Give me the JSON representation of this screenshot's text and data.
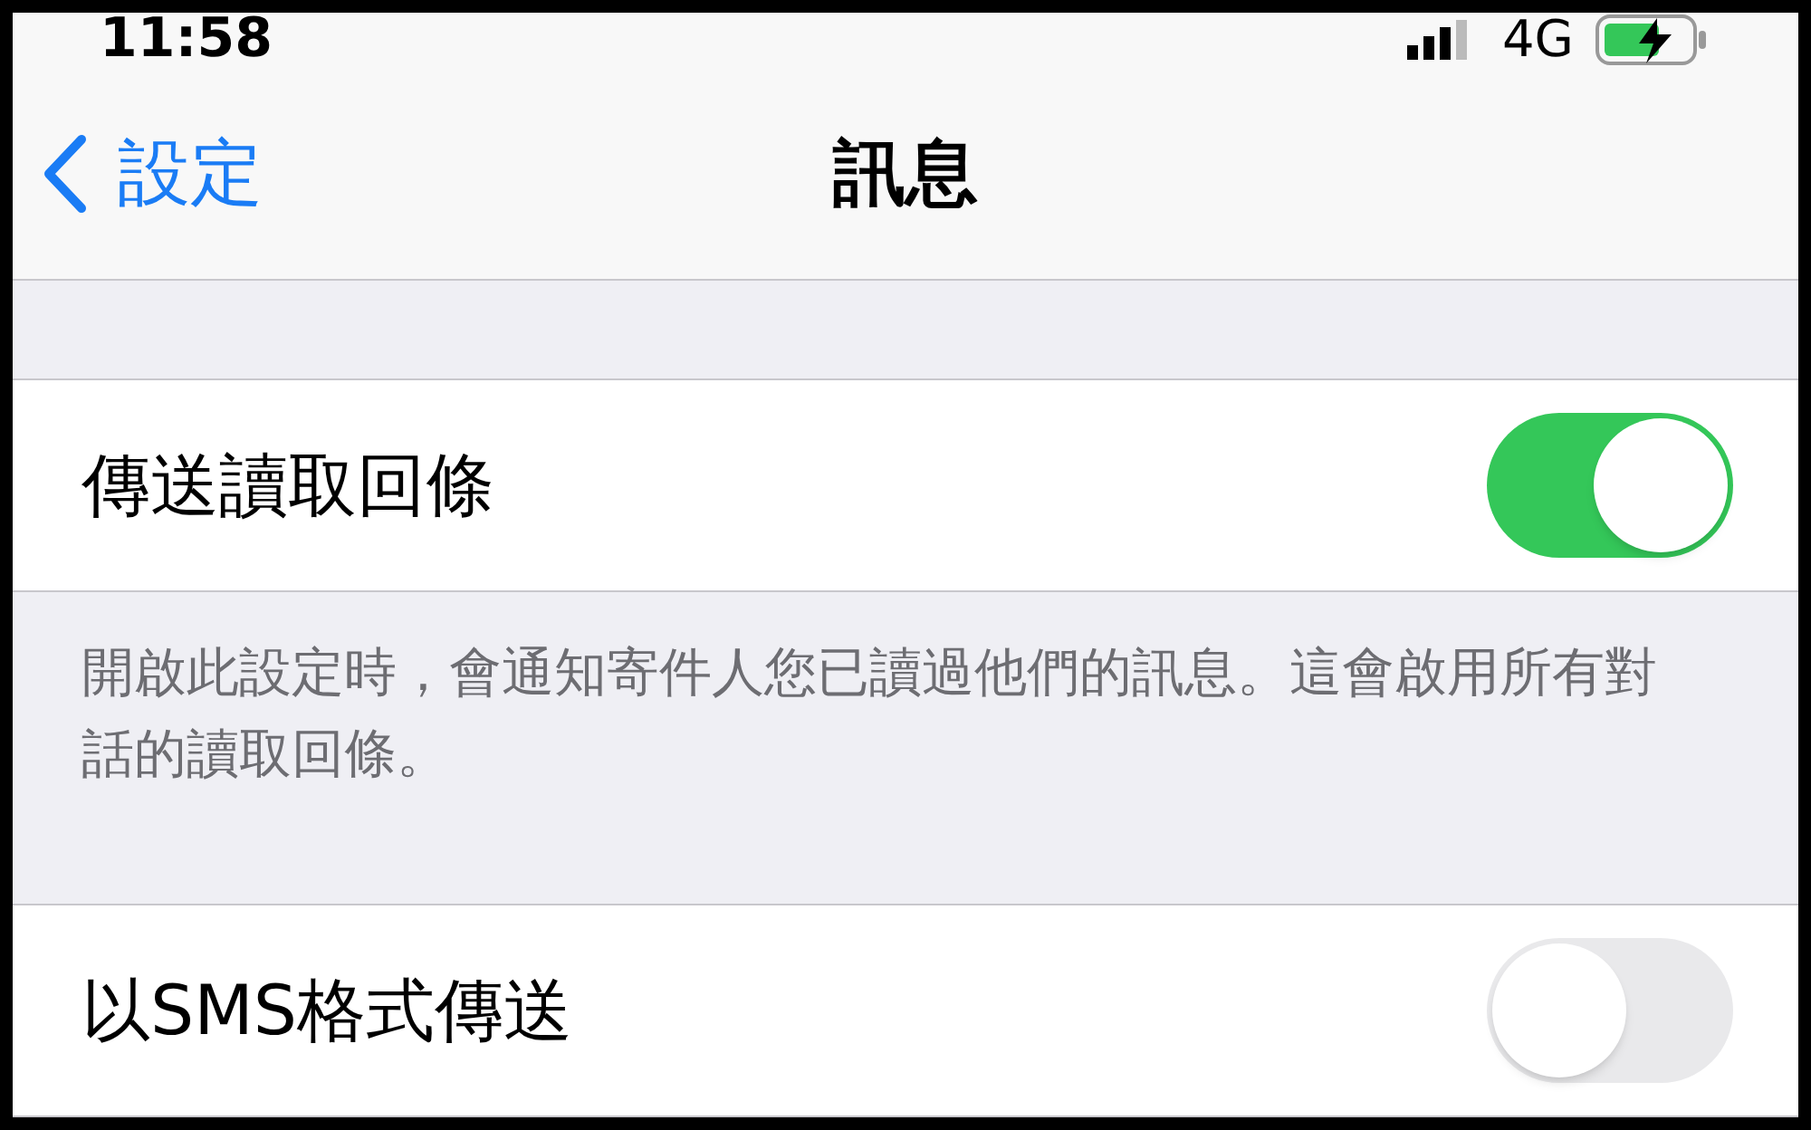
{
  "status_bar": {
    "time": "11:58",
    "network": "4G"
  },
  "nav": {
    "back": "設定",
    "title": "訊息"
  },
  "settings": [
    {
      "label": "傳送讀取回條",
      "on": true,
      "footer": "開啟此設定時，會通知寄件人您已讀過他們的訊息。這會啟用所有對話的讀取回條。"
    },
    {
      "label": "以SMS格式傳送",
      "on": false
    }
  ]
}
